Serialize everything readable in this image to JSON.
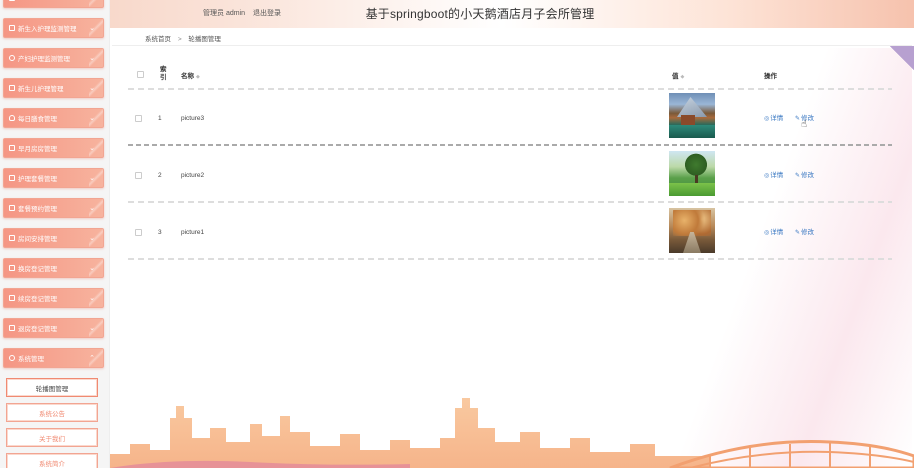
{
  "header": {
    "title": "基于springboot的小天鹅酒店月子会所管理",
    "role_label": "管理员 admin",
    "logout_label": "退出登录"
  },
  "breadcrumb": {
    "home": "系统首页",
    "current": "轮播图管理"
  },
  "sidebar": {
    "items": [
      {
        "label": "新生入护理监测管理",
        "icon": "grid-icon"
      },
      {
        "label": "产妇护理监测管理",
        "icon": "pin-icon"
      },
      {
        "label": "新生儿护理管理",
        "icon": "grid-icon"
      },
      {
        "label": "每日膳食管理",
        "icon": "person-icon"
      },
      {
        "label": "早月房房管理",
        "icon": "grid-icon"
      },
      {
        "label": "护理套餐管理",
        "icon": "flag-icon"
      },
      {
        "label": "套餐预约管理",
        "icon": "grid-icon"
      },
      {
        "label": "房间安排管理",
        "icon": "grid-icon"
      },
      {
        "label": "换房登记管理",
        "icon": "monitor-icon"
      },
      {
        "label": "续房登记管理",
        "icon": "list-icon"
      },
      {
        "label": "退房登记管理",
        "icon": "sliders-icon"
      },
      {
        "label": "系统管理",
        "icon": "send-icon"
      }
    ],
    "sub_items": [
      {
        "label": "轮播图管理",
        "active": true
      },
      {
        "label": "系统公告",
        "active": false
      },
      {
        "label": "关于我们",
        "active": false
      },
      {
        "label": "系统简介",
        "active": false
      }
    ]
  },
  "table": {
    "columns": {
      "index": "索引",
      "name": "名称",
      "value": "值",
      "actions": "操作"
    },
    "rows": [
      {
        "index": "1",
        "name": "picture3",
        "thumb": "picture3"
      },
      {
        "index": "2",
        "name": "picture2",
        "thumb": "picture2"
      },
      {
        "index": "3",
        "name": "picture1",
        "thumb": "picture1"
      }
    ],
    "detail_label": "详情",
    "edit_label": "修改"
  },
  "colors": {
    "accent": "#f59684",
    "link": "#3a78c2"
  }
}
